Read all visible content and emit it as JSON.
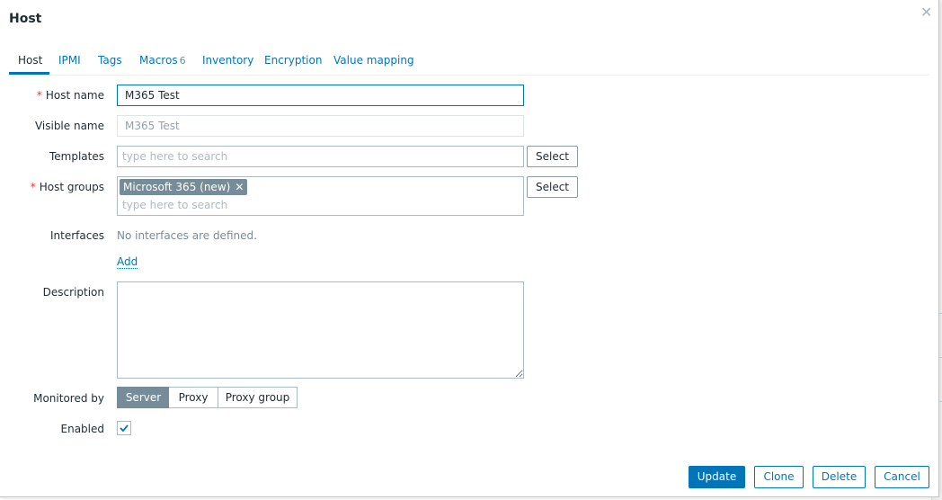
{
  "dialog": {
    "title": "Host",
    "close_icon": "close-icon"
  },
  "tabs": [
    {
      "label": "Host",
      "active": true
    },
    {
      "label": "IPMI"
    },
    {
      "label": "Tags"
    },
    {
      "label": "Macros",
      "badge": "6"
    },
    {
      "label": "Inventory"
    },
    {
      "label": "Encryption"
    },
    {
      "label": "Value mapping"
    }
  ],
  "form": {
    "required_mark": "*",
    "host_name": {
      "label": "Host name",
      "value": "M365 Test"
    },
    "visible_name": {
      "label": "Visible name",
      "placeholder": "M365 Test"
    },
    "templates": {
      "label": "Templates",
      "placeholder": "type here to search",
      "select_label": "Select"
    },
    "host_groups": {
      "label": "Host groups",
      "chips": [
        "Microsoft 365 (new)"
      ],
      "chip_remove": "✕",
      "placeholder": "type here to search",
      "select_label": "Select"
    },
    "interfaces": {
      "label": "Interfaces",
      "empty_text": "No interfaces are defined.",
      "add_label": "Add"
    },
    "description": {
      "label": "Description",
      "value": ""
    },
    "monitored_by": {
      "label": "Monitored by",
      "options": [
        "Server",
        "Proxy",
        "Proxy group"
      ],
      "selected": "Server"
    },
    "enabled": {
      "label": "Enabled",
      "checked": true
    }
  },
  "footer": {
    "update": "Update",
    "clone": "Clone",
    "delete": "Delete",
    "cancel": "Cancel"
  },
  "colors": {
    "accent": "#0275b8",
    "required": "#e33734",
    "chip": "#768d99"
  }
}
